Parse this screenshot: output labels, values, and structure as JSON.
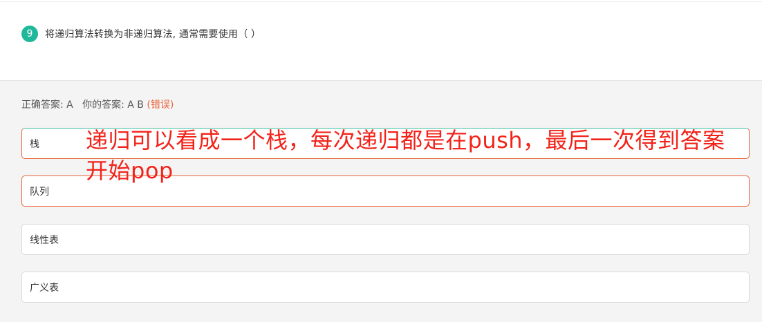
{
  "question": {
    "number": "9",
    "text": "将递归算法转换为非递归算法, 通常需要使用（ ）"
  },
  "answer": {
    "correct_label": "正确答案: ",
    "correct_value": "A",
    "yours_label": "你的答案: ",
    "yours_value": "A B",
    "status": "(错误)"
  },
  "options": [
    {
      "label": "栈",
      "state": "wrong-selected"
    },
    {
      "label": "队列",
      "state": "wrong-selected"
    },
    {
      "label": "线性表",
      "state": "unselected"
    },
    {
      "label": "广义表",
      "state": "unselected"
    }
  ],
  "annotation": {
    "text": "递归可以看成一个栈，每次递归都是在push，最后一次得到答案开始pop",
    "color": "#f2231a"
  },
  "colors": {
    "accent": "#1fb89a",
    "error": "#e8653a"
  }
}
